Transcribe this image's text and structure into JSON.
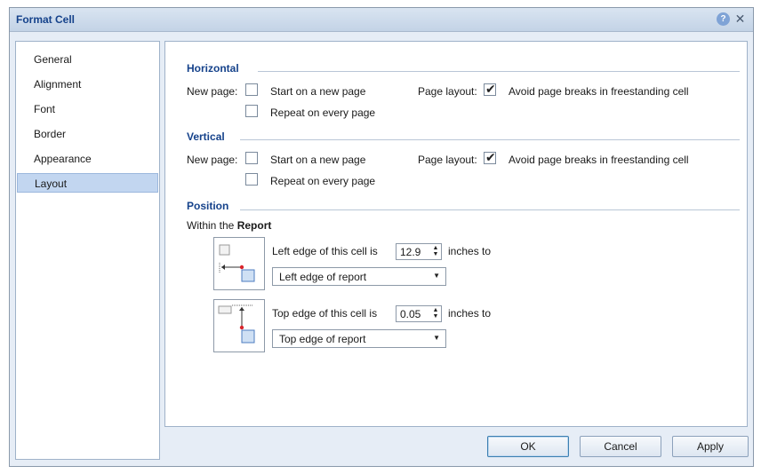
{
  "dialog": {
    "title": "Format Cell",
    "help_icon": "help-icon",
    "close_icon": "close-icon"
  },
  "nav": {
    "items": [
      {
        "label": "General",
        "selected": false
      },
      {
        "label": "Alignment",
        "selected": false
      },
      {
        "label": "Font",
        "selected": false
      },
      {
        "label": "Border",
        "selected": false
      },
      {
        "label": "Appearance",
        "selected": false
      },
      {
        "label": "Layout",
        "selected": true
      }
    ]
  },
  "horizontal": {
    "title": "Horizontal",
    "new_page_label": "New page:",
    "start_new_page": {
      "label": "Start on a new page",
      "checked": false
    },
    "repeat_every_page": {
      "label": "Repeat on every page",
      "checked": false
    },
    "page_layout_label": "Page layout:",
    "avoid_breaks": {
      "label": "Avoid page breaks in freestanding cell",
      "checked": true
    }
  },
  "vertical": {
    "title": "Vertical",
    "new_page_label": "New page:",
    "start_new_page": {
      "label": "Start on a new page",
      "checked": false
    },
    "repeat_every_page": {
      "label": "Repeat on every page",
      "checked": false
    },
    "page_layout_label": "Page layout:",
    "avoid_breaks": {
      "label": "Avoid page breaks in freestanding cell",
      "checked": true
    }
  },
  "position": {
    "title": "Position",
    "within_prefix": "Within the ",
    "within_target": "Report",
    "left": {
      "label": "Left edge of this cell is",
      "value": "12.9",
      "unit_label": "inches to",
      "anchor": "Left edge of report"
    },
    "top": {
      "label": "Top edge of this cell is",
      "value": "0.05",
      "unit_label": "inches to",
      "anchor": "Top edge of report"
    }
  },
  "buttons": {
    "ok": "OK",
    "cancel": "Cancel",
    "apply": "Apply"
  },
  "colors": {
    "title_text": "#15428b",
    "dialog_bg": "#e6edf6",
    "selected_nav": "#c2d6f0",
    "anchor_dot": "#d9252c"
  }
}
